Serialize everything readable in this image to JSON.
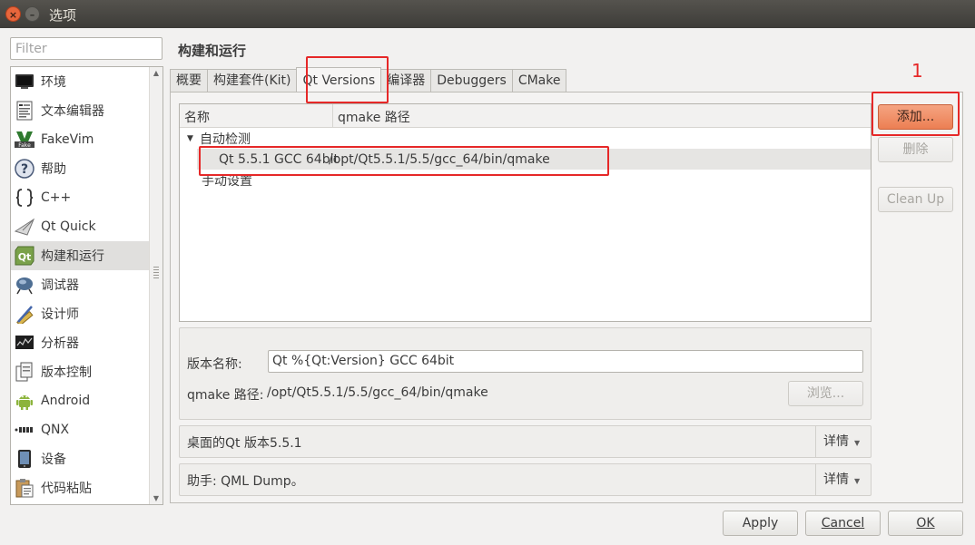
{
  "window": {
    "title": "选项",
    "close_glyph": "×",
    "min_glyph": "–"
  },
  "filter": {
    "placeholder": "Filter",
    "value": ""
  },
  "nav": {
    "items": [
      {
        "label": "环境",
        "icon": "monitor-icon"
      },
      {
        "label": "文本编辑器",
        "icon": "text-document-icon"
      },
      {
        "label": "FakeVim",
        "icon": "fakevim-icon"
      },
      {
        "label": "帮助",
        "icon": "help-icon"
      },
      {
        "label": "C++",
        "icon": "braces-icon"
      },
      {
        "label": "Qt Quick",
        "icon": "paper-plane-icon"
      },
      {
        "label": "构建和运行",
        "icon": "qt-build-run-icon"
      },
      {
        "label": "调试器",
        "icon": "debugger-bug-icon"
      },
      {
        "label": "设计师",
        "icon": "pen-ruler-icon"
      },
      {
        "label": "分析器",
        "icon": "analyzer-chart-icon"
      },
      {
        "label": "版本控制",
        "icon": "version-control-icon"
      },
      {
        "label": "Android",
        "icon": "android-icon"
      },
      {
        "label": "QNX",
        "icon": "qnx-logo-icon"
      },
      {
        "label": "设备",
        "icon": "device-phone-icon"
      },
      {
        "label": "代码粘贴",
        "icon": "clipboard-icon"
      }
    ],
    "selected_index": 6
  },
  "page_title": "构建和运行",
  "tabs": [
    {
      "label": "概要"
    },
    {
      "label": "构建套件(Kit)"
    },
    {
      "label": "Qt Versions"
    },
    {
      "label": "编译器"
    },
    {
      "label": "Debuggers"
    },
    {
      "label": "CMake"
    }
  ],
  "active_tab": 2,
  "tree": {
    "col_name": "名称",
    "col_path": "qmake 路径",
    "auto_group": "自动检测",
    "manual_group": "手动设置",
    "versions": [
      {
        "name": "Qt 5.5.1 GCC 64bit",
        "path": "/opt/Qt5.5.1/5.5/gcc_64/bin/qmake"
      }
    ]
  },
  "side_buttons": {
    "add": "添加...",
    "remove": "删除",
    "cleanup": "Clean Up"
  },
  "details": {
    "version_name_label": "版本名称:",
    "version_name_value": "Qt %{Qt:Version} GCC 64bit",
    "qmake_label": "qmake 路径:",
    "qmake_value": "/opt/Qt5.5.1/5.5/gcc_64/bin/qmake",
    "browse": "浏览..."
  },
  "info_rows": [
    {
      "text": "桌面的Qt 版本5.5.1",
      "details": "详情"
    },
    {
      "text": "助手: QML Dump。",
      "details": "详情"
    }
  ],
  "dialog_buttons": {
    "apply": "Apply",
    "cancel": "Cancel",
    "ok": "OK"
  },
  "annotation": {
    "number": "1"
  },
  "colors": {
    "accent_orange": "#ec7f53",
    "annotation_red": "#e62828",
    "selection": "#e0dfdd"
  }
}
